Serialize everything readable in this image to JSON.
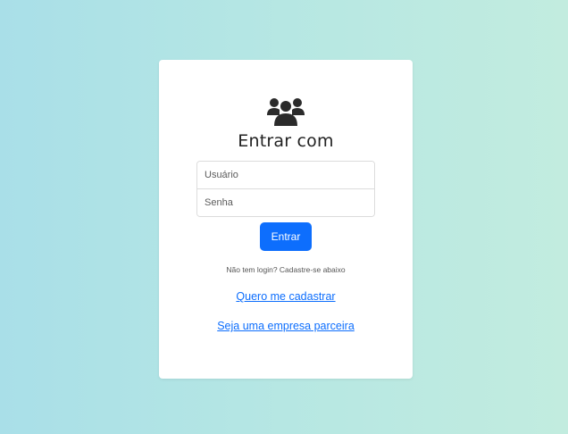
{
  "colors": {
    "primary": "#0d6efd",
    "background_left": "#a9dfe8",
    "background_right": "#c2ecdf",
    "icon": "#2b2b2b"
  },
  "login": {
    "icon": "users-icon",
    "title": "Entrar com",
    "username_placeholder": "Usuário",
    "password_placeholder": "Senha",
    "submit_label": "Entrar",
    "hint": "Não tem login? Cadastre-se abaixo",
    "register_link": "Quero me cadastrar",
    "partner_link": "Seja uma empresa parceira"
  }
}
